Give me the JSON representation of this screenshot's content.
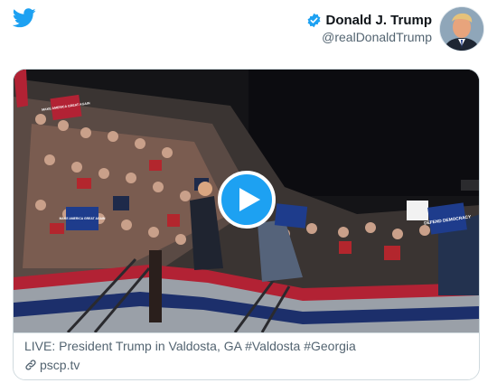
{
  "header": {
    "brand_icon": "twitter-bird-icon",
    "brand_color": "#1da1f2",
    "author_name": "Donald J. Trump",
    "author_handle": "@realDonaldTrump",
    "verified_icon": "verified-badge-icon",
    "avatar_icon": "profile-avatar"
  },
  "card": {
    "media_icon": "video-thumbnail",
    "play_icon": "play-icon",
    "play_color": "#1da1f2",
    "signs": {
      "make_america_great_again_1": "MAKE AMERICA GREAT AGAIN",
      "make_america_great_again_2": "MAKE AMERICA GREAT AGAIN",
      "defend_democracy": "DEFEND DEMOCRACY"
    },
    "title": "LIVE: President Trump in Valdosta, GA #Valdosta #Georgia",
    "domain_icon": "link-icon",
    "domain": "pscp.tv"
  }
}
